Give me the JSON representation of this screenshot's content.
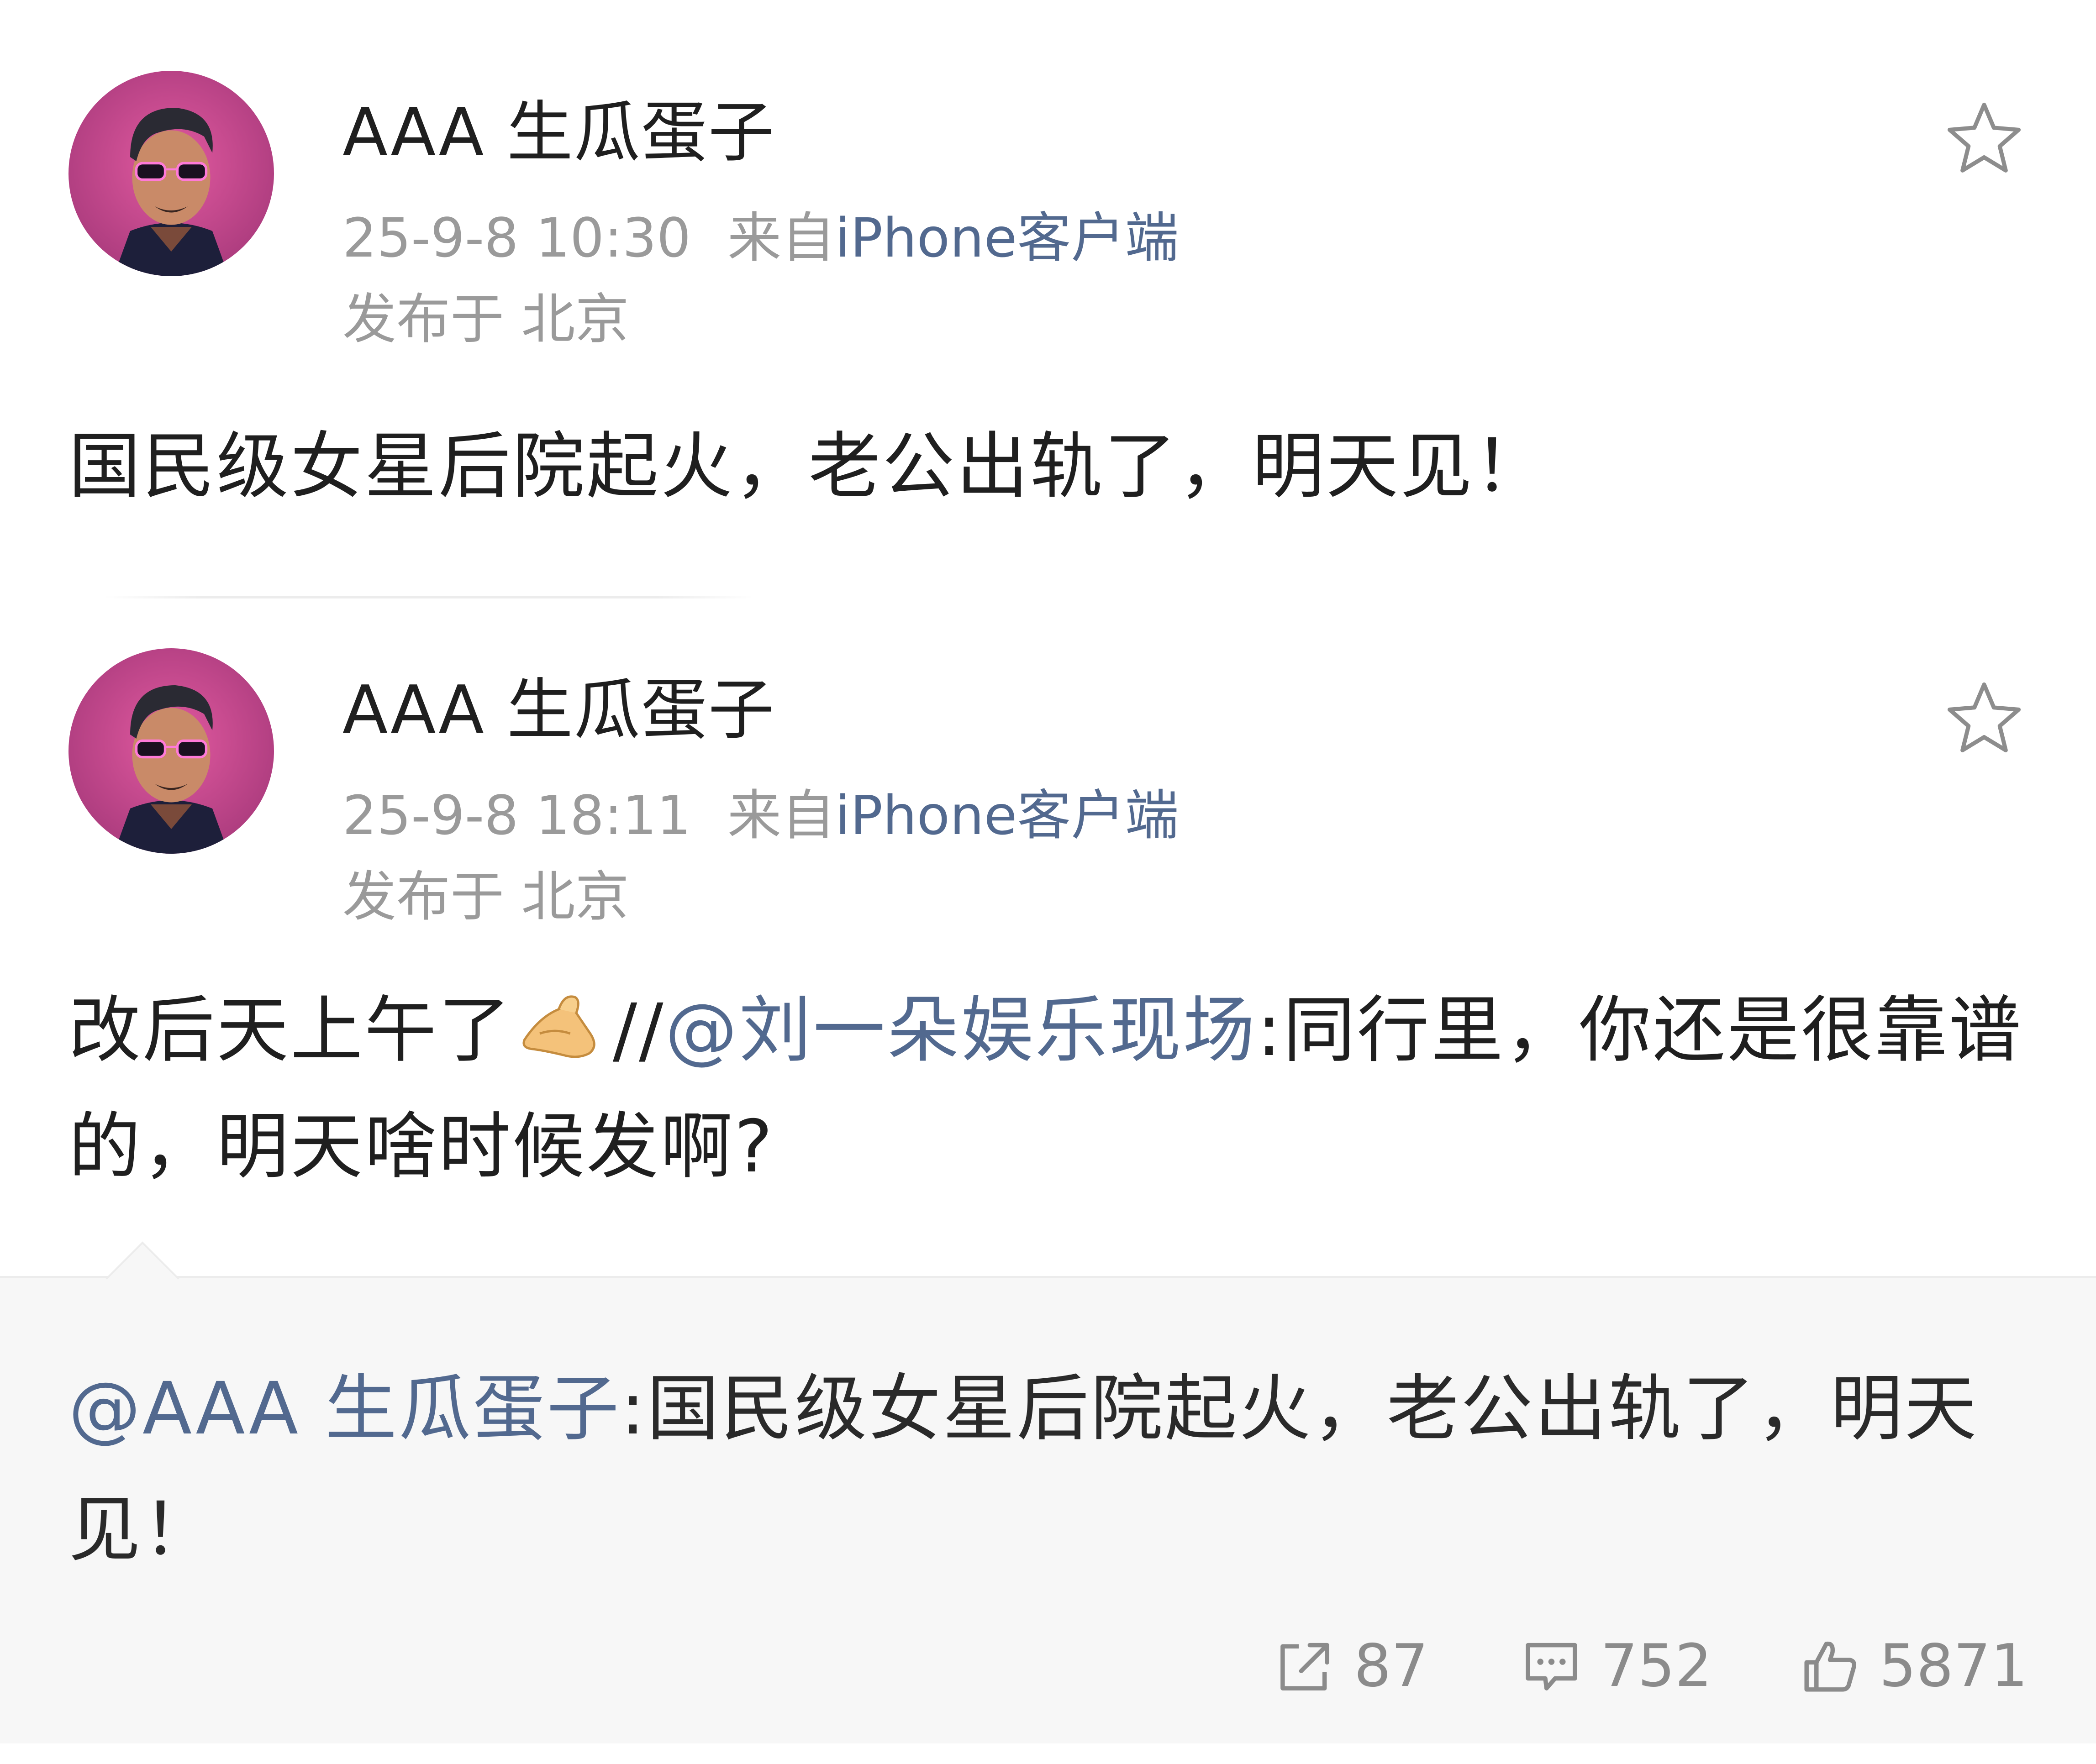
{
  "posts": [
    {
      "username": "AAA 生瓜蛋子",
      "time": "25-9-8 10:30",
      "source_prefix": "来自",
      "source_client": "iPhone客户端",
      "location": "发布于 北京",
      "text": "国民级女星后院起火，老公出轨了，明天见！"
    },
    {
      "username": "AAA 生瓜蛋子",
      "time": "25-9-8 18:11",
      "source_prefix": "来自",
      "source_client": "iPhone客户端",
      "location": "发布于 北京",
      "text_part1": "改后天上午了",
      "text_part2": "//",
      "text_mention": "@刘一朵娱乐现场",
      "text_part3": ":同行里，你还是很靠谱的，明天啥时候发啊?"
    }
  ],
  "repost": {
    "mention": "@AAA 生瓜蛋子",
    "text": ":国民级女星后院起火，老公出轨了，明天见！"
  },
  "actions": {
    "repost_count": "87",
    "comment_count": "752",
    "like_count": "5871"
  },
  "icons": {
    "favorite": "star-outline-icon",
    "repost": "share-arrow-icon",
    "comment": "comment-bubble-icon",
    "like": "thumbs-up-icon",
    "emoji": "pinching-hand-emoji"
  },
  "colors": {
    "link": "#52698f",
    "meta": "#9a9a9a",
    "text": "#1f1f1f",
    "repost_bg": "#f7f7f7"
  }
}
